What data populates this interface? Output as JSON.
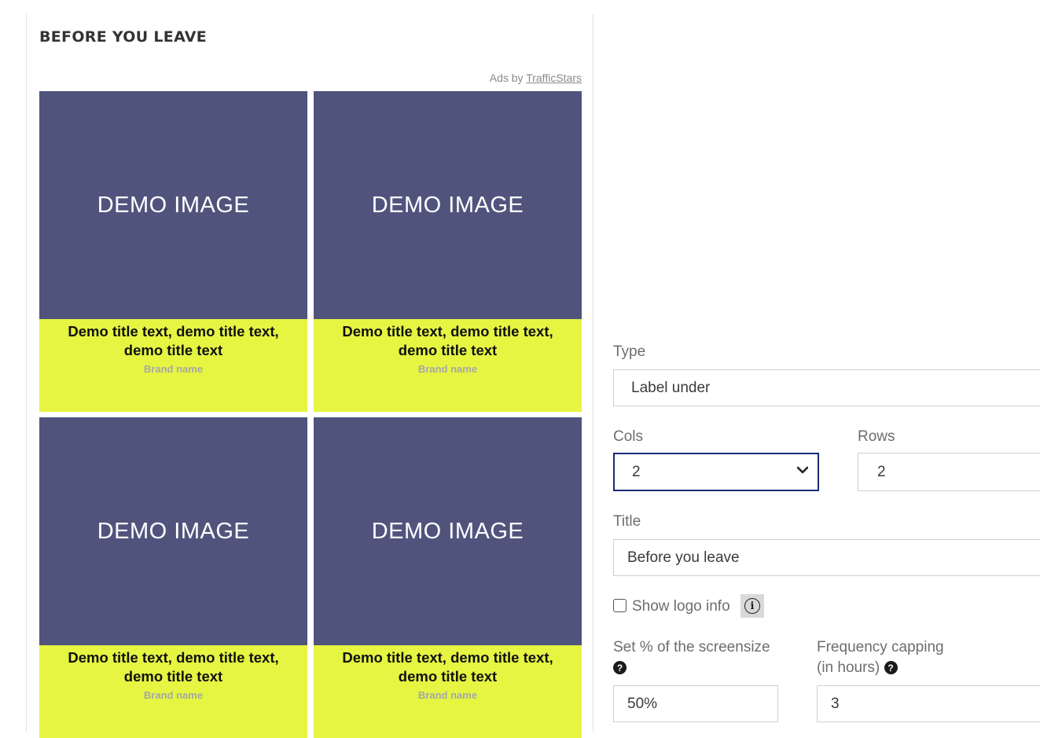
{
  "preview": {
    "title": "BEFORE YOU LEAVE",
    "ads_by": "Ads by",
    "ads_provider": "TrafficStars",
    "ads": [
      {
        "image_label": "DEMO IMAGE",
        "title_line1": "Demo title text, demo title text,",
        "title_line2": "demo title text",
        "brand": "Brand name"
      },
      {
        "image_label": "DEMO IMAGE",
        "title_line1": "Demo title text, demo title text,",
        "title_line2": "demo title text",
        "brand": "Brand name"
      },
      {
        "image_label": "DEMO IMAGE",
        "title_line1": "Demo title text, demo title text,",
        "title_line2": "demo title text",
        "brand": "Brand name"
      },
      {
        "image_label": "DEMO IMAGE",
        "title_line1": "Demo title text, demo title text,",
        "title_line2": "demo title text",
        "brand": "Brand name"
      }
    ],
    "colors": {
      "image_bg": "#50547d",
      "label_bg": "#e5f542"
    }
  },
  "form": {
    "type_label": "Type",
    "type_value": "Label under",
    "cols_label": "Cols",
    "cols_value": "2",
    "rows_label": "Rows",
    "rows_value": "2",
    "title_label": "Title",
    "title_value": "Before you leave",
    "show_logo_label": "Show logo info",
    "show_logo_checked": false,
    "screensize_label": "Set % of the screensize",
    "screensize_value": "50%",
    "freq_label_line1": "Frequency capping",
    "freq_label_line2": "(in hours)",
    "freq_value": "3",
    "icons": {
      "help": "question-circle-icon",
      "info": "info-circle-icon",
      "chevron": "chevron-down-icon"
    }
  }
}
